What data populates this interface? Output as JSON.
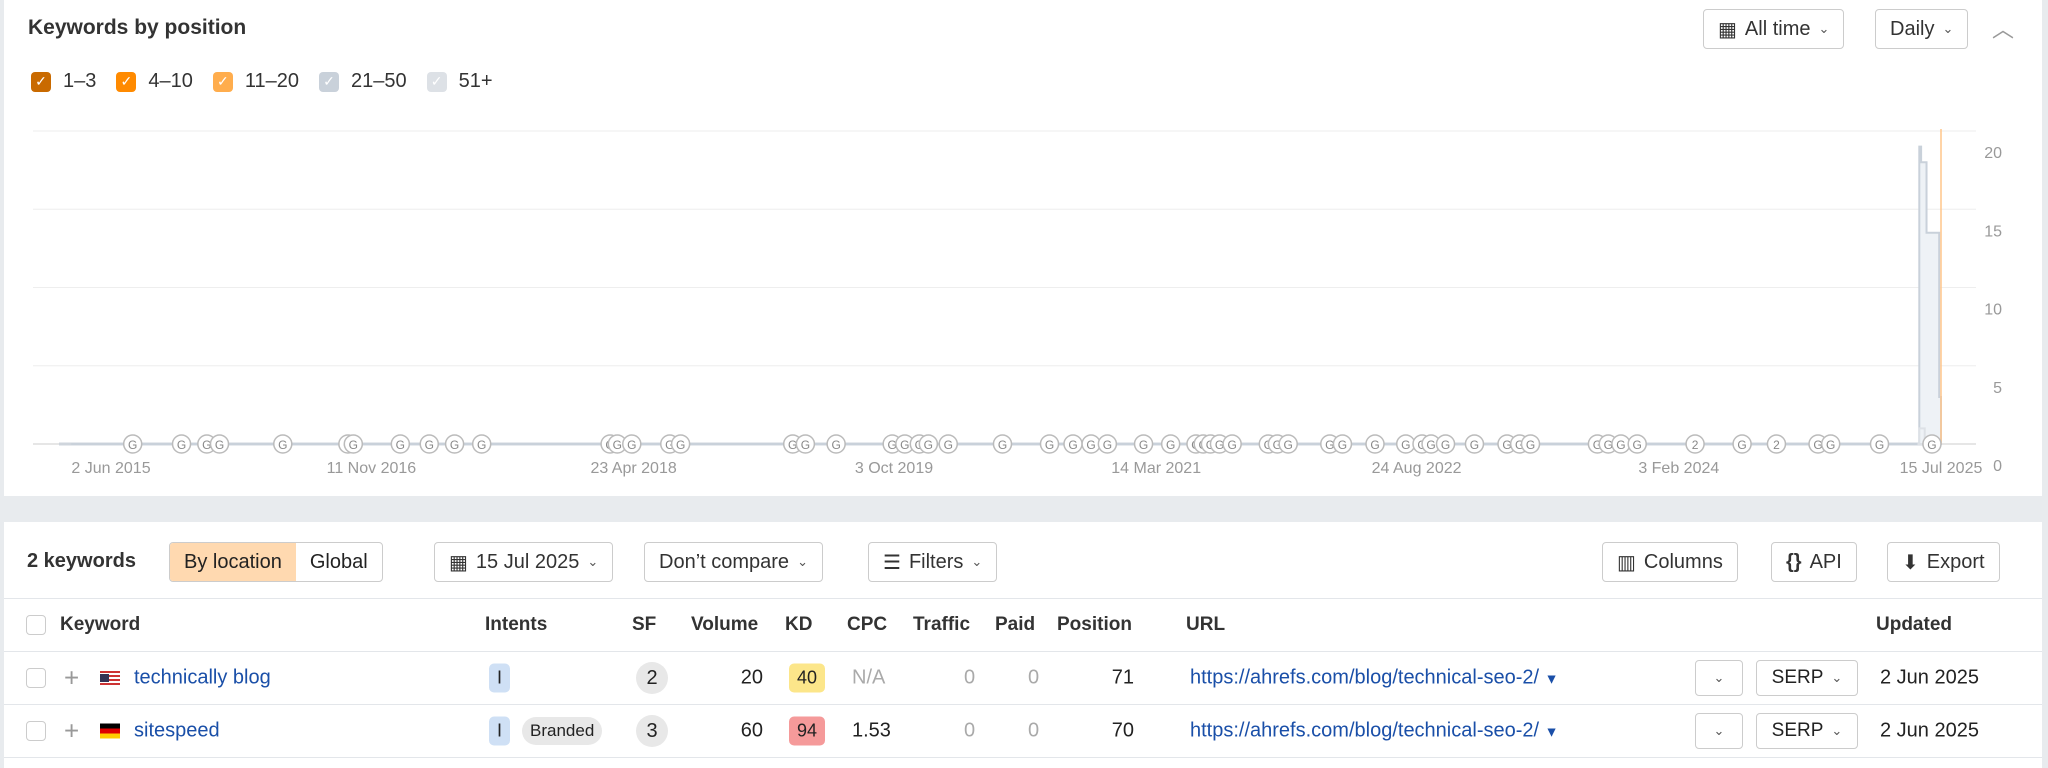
{
  "chart_section": {
    "title": "Keywords by position",
    "time_range": "All time",
    "interval": "Daily",
    "collapse_icon": "chevron-up-icon",
    "legend": [
      {
        "label": "1–3",
        "color": "#c96a00"
      },
      {
        "label": "4–10",
        "color": "#ff8a00"
      },
      {
        "label": "11–20",
        "color": "#ffad4d"
      },
      {
        "label": "21–50",
        "color": "#c9d1da"
      },
      {
        "label": "51+",
        "color": "#dde1e6"
      }
    ]
  },
  "chart_data": {
    "type": "area",
    "title": "Keywords by position",
    "xlabel": "",
    "ylabel": "",
    "x_ticks": [
      "2 Jun 2015",
      "11 Nov 2016",
      "23 Apr 2018",
      "3 Oct 2019",
      "14 Mar 2021",
      "24 Aug 2022",
      "3 Feb 2024",
      "15 Jul 2025"
    ],
    "x_tick_years": [
      2015.42,
      2016.86,
      2018.31,
      2019.75,
      2021.2,
      2022.64,
      2024.09,
      2025.54
    ],
    "xlim": [
      2015.42,
      2025.54
    ],
    "y_ticks": [
      "20",
      "15",
      "10",
      "5",
      "0"
    ],
    "ylim": [
      0,
      20
    ],
    "grid": true,
    "series": [
      {
        "name": "21–50",
        "color": "#c9d1da",
        "points": [
          [
            2015.2,
            0
          ],
          [
            2025.41,
            0
          ],
          [
            2025.42,
            19
          ],
          [
            2025.43,
            18
          ],
          [
            2025.46,
            13.5
          ],
          [
            2025.52,
            13.5
          ],
          [
            2025.53,
            3
          ],
          [
            2025.54,
            0
          ]
        ]
      },
      {
        "name": "51+",
        "color": "#dde1e6",
        "points": [
          [
            2025.41,
            0
          ],
          [
            2025.42,
            1
          ],
          [
            2025.44,
            1
          ],
          [
            2025.45,
            0
          ]
        ]
      }
    ],
    "marker_line_year": 2025.54,
    "google_updates": [
      2015.54,
      2015.81,
      2015.95,
      2016.02,
      2016.37,
      2016.73,
      2016.76,
      2017.02,
      2017.18,
      2017.32,
      2017.47,
      2018.18,
      2018.22,
      2018.3,
      2018.51,
      2018.57,
      2019.19,
      2019.26,
      2019.43,
      2019.74,
      2019.81,
      2019.89,
      2019.94,
      2020.05,
      2020.35,
      2020.61,
      2020.74,
      2020.84,
      2020.93,
      2021.13,
      2021.28,
      2021.42,
      2021.46,
      2021.5,
      2021.55,
      2021.62,
      2021.82,
      2021.87,
      2021.93,
      2022.16,
      2022.23,
      2022.41,
      2022.58,
      2022.67,
      2022.72,
      2022.8,
      2022.96,
      2023.14,
      2023.21,
      2023.27,
      2023.64,
      2023.7,
      2023.77,
      2023.86,
      2024.18,
      2024.44,
      2024.63,
      2024.86,
      2024.93,
      2025.2,
      2025.49
    ],
    "google_update_labels": {
      "2024.18": "2",
      "2024.63": "2"
    },
    "marker_default_label": "G"
  },
  "toolbar": {
    "count": "2 keywords",
    "by_location": "By location",
    "global": "Global",
    "date": "15 Jul 2025",
    "compare": "Don’t compare",
    "filters": "Filters",
    "columns": "Columns",
    "api": "API",
    "export": "Export"
  },
  "table": {
    "headers": {
      "keyword": "Keyword",
      "intents": "Intents",
      "sf": "SF",
      "volume": "Volume",
      "kd": "KD",
      "cpc": "CPC",
      "traffic": "Traffic",
      "paid": "Paid",
      "position": "Position",
      "url": "URL",
      "updated": "Updated"
    },
    "rows": [
      {
        "keyword": "technically blog",
        "flag": "us",
        "intent": "I",
        "branded": "",
        "sf": "2",
        "volume": "20",
        "kd": "40",
        "kd_color": "#fce68a",
        "cpc": "N/A",
        "traffic": "0",
        "paid": "0",
        "position": "71",
        "url": "https://ahrefs.com/blog/technical-seo-2/",
        "serp": "SERP",
        "updated": "2 Jun 2025"
      },
      {
        "keyword": "sitespeed",
        "flag": "de",
        "intent": "I",
        "branded": "Branded",
        "sf": "3",
        "volume": "60",
        "kd": "94",
        "kd_color": "#f59a9a",
        "cpc": "1.53",
        "traffic": "0",
        "paid": "0",
        "position": "70",
        "url": "https://ahrefs.com/blog/technical-seo-2/",
        "serp": "SERP",
        "updated": "2 Jun 2025"
      }
    ]
  }
}
